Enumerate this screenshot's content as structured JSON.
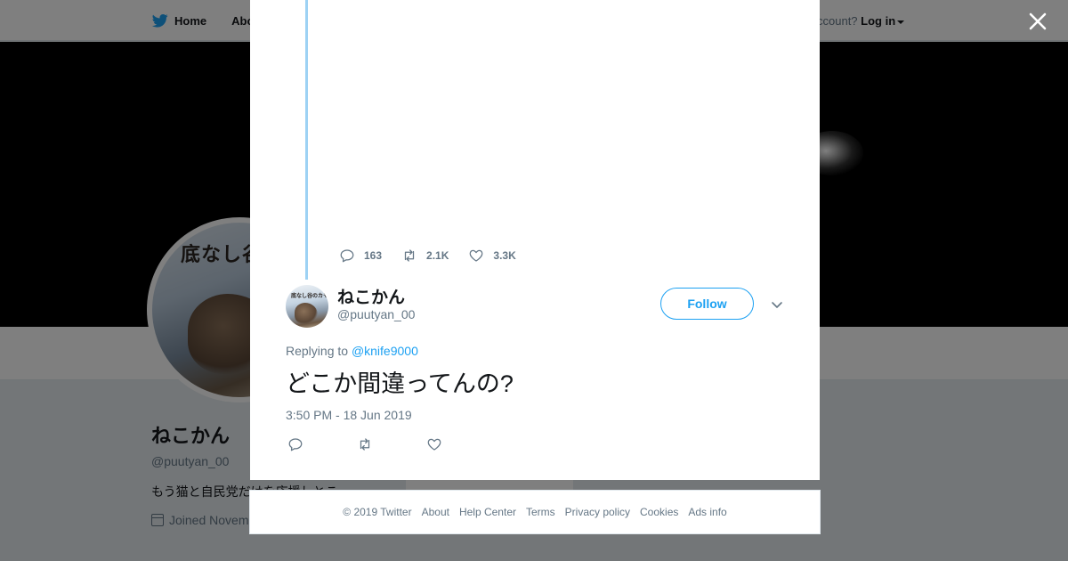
{
  "background": {
    "nav": {
      "home_label": "Home",
      "about_label": "Abo"
    },
    "login": {
      "prompt": "ccount?",
      "login_label": "Log in"
    },
    "profile_card": {
      "avatar_text": "底なし谷の",
      "name": "ねこかん",
      "handle": "@puutyan_00",
      "bio": "もう猫と自民党だけを応援しとこ",
      "joined": "Joined Novem"
    },
    "ads_info": "Ads info"
  },
  "modal": {
    "previous_tweet": {
      "reply_count": "163",
      "retweet_count": "2.1K",
      "like_count": "3.3K"
    },
    "tweet": {
      "author_name": "ねこかん",
      "author_handle": "@puutyan_00",
      "avatar_text": "底なし谷のカモシカ",
      "follow_label": "Follow",
      "replying_prefix": "Replying to ",
      "replying_to": "@knife9000",
      "text": "どこか間違ってんの?",
      "timestamp": "3:50 PM - 18 Jun 2019"
    }
  },
  "footer": {
    "copyright": "© 2019 Twitter",
    "links": [
      "About",
      "Help Center",
      "Terms",
      "Privacy policy",
      "Cookies",
      "Ads info"
    ]
  },
  "colors": {
    "accent": "#1da1f2",
    "thread_line": "#9dd2f4",
    "muted_text": "#657786",
    "primary_text": "#14171a",
    "overlay": "rgba(0,0,0,0.5)"
  },
  "icons": [
    "twitter-bird-icon",
    "close-icon",
    "reply-icon",
    "retweet-icon",
    "like-icon",
    "chevron-down-icon",
    "calendar-icon"
  ]
}
